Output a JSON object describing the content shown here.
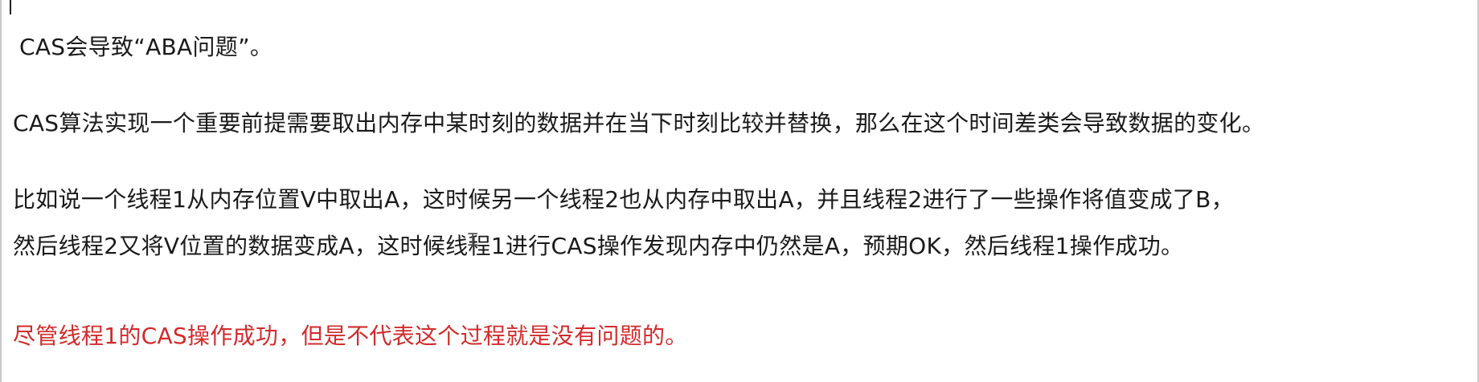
{
  "document": {
    "lines": [
      "CAS会导致“ABA问题”。",
      "CAS算法实现一个重要前提需要取出内存中某时刻的数据并在当下时刻比较并替换，那么在这个时间差类会导致数据的变化。",
      "比如说一个线程1从内存位置V中取出A，这时候另一个线程2也从内存中取出A，并且线程2进行了一些操作将值变成了B，",
      "然后线程2又将V位置的数据变成A，这时候线程1进行CAS操作发现内存中仍然是A，预期OK，然后线程1操作成功。",
      "尽管线程1的CAS操作成功，但是不代表这个过程就是没有问题的。"
    ],
    "highlight_color": "#d22b2b"
  }
}
